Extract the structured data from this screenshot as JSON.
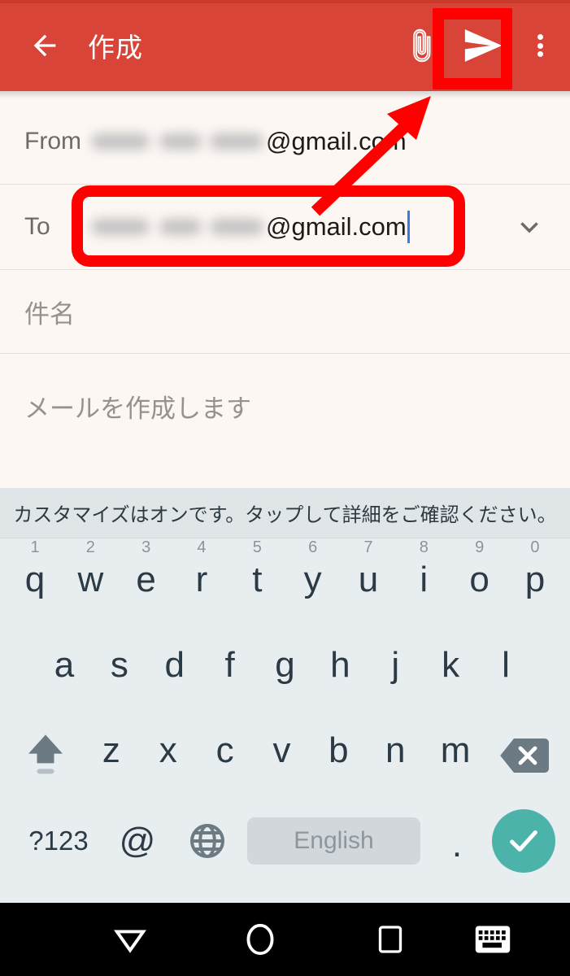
{
  "appbar": {
    "back_icon": "arrow-left-icon",
    "title": "作成",
    "attach_icon": "paperclip-icon",
    "send_icon": "send-icon",
    "more_icon": "overflow-menu-icon",
    "background_color": "#d84437"
  },
  "compose": {
    "from": {
      "label": "From",
      "value_blurred": true,
      "value_suffix": "@gmail.com"
    },
    "to": {
      "label": "To",
      "value_blurred": true,
      "value_suffix": "@gmail.com",
      "cursor_visible": true,
      "expand_icon": "chevron-down-icon"
    },
    "subject": {
      "placeholder": "件名",
      "value": ""
    },
    "body": {
      "placeholder": "メールを作成します",
      "value": ""
    }
  },
  "annotations": {
    "highlight_color": "#ff0000",
    "send_button_box": "send-button-highlight",
    "to_field_box": "to-field-highlight",
    "arrow": "annotation-arrow-to-send"
  },
  "keyboard": {
    "suggestion_bar": "カスタマイズはオンです。タップして詳細をご確認ください。",
    "row1": [
      {
        "key": "q",
        "num": "1"
      },
      {
        "key": "w",
        "num": "2"
      },
      {
        "key": "e",
        "num": "3"
      },
      {
        "key": "r",
        "num": "4"
      },
      {
        "key": "t",
        "num": "5"
      },
      {
        "key": "y",
        "num": "6"
      },
      {
        "key": "u",
        "num": "7"
      },
      {
        "key": "i",
        "num": "8"
      },
      {
        "key": "o",
        "num": "9"
      },
      {
        "key": "p",
        "num": "0"
      }
    ],
    "row2": [
      "a",
      "s",
      "d",
      "f",
      "g",
      "h",
      "j",
      "k",
      "l"
    ],
    "row3": {
      "shift_icon": "shift-icon",
      "keys": [
        "z",
        "x",
        "c",
        "v",
        "b",
        "n",
        "m"
      ],
      "backspace_icon": "backspace-icon"
    },
    "row4": {
      "symbols_label": "?123",
      "at_label": "@",
      "globe_icon": "globe-icon",
      "space_label": "English",
      "period_label": ".",
      "enter_icon": "check-icon",
      "enter_color": "#4cb3aa"
    },
    "background_color": "#e8edf0"
  },
  "navbar": {
    "back_icon": "triangle-down-icon",
    "home_icon": "circle-icon",
    "recents_icon": "square-icon",
    "keyboard_icon": "keyboard-icon",
    "background_color": "#000000"
  }
}
